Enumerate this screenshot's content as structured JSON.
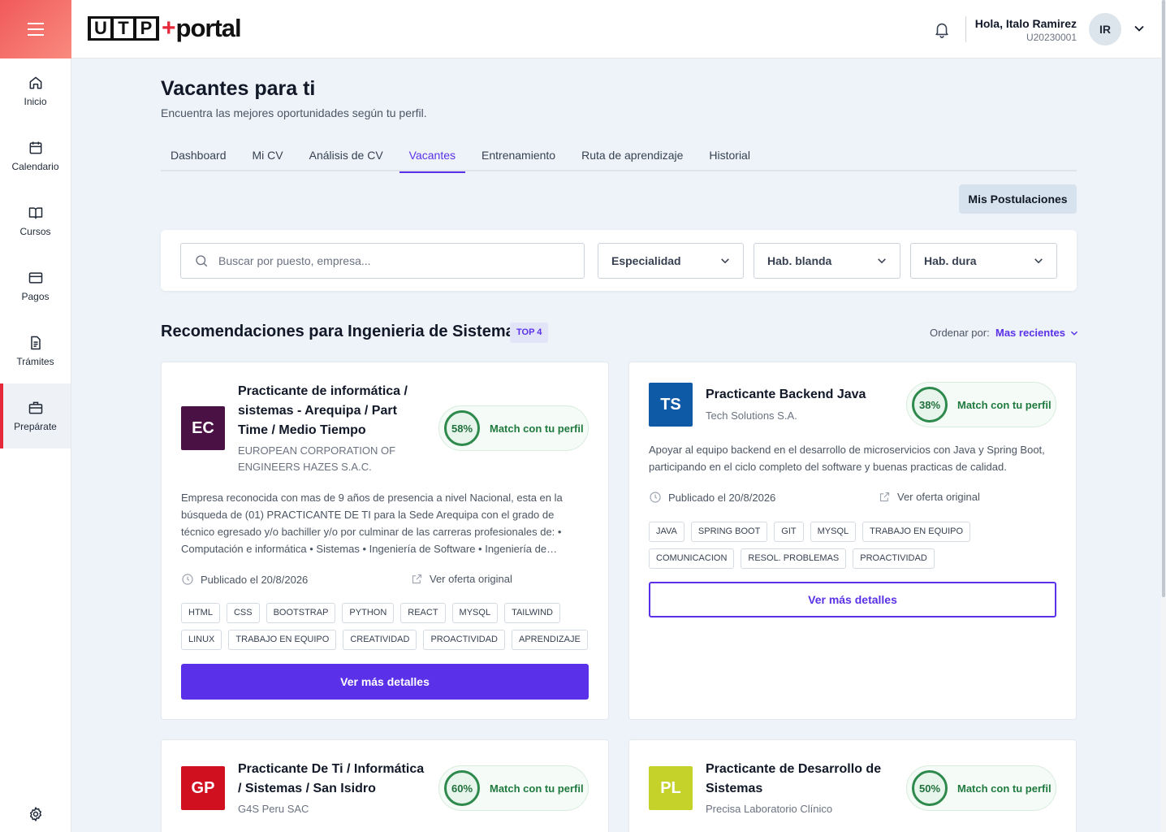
{
  "sidebar": {
    "items": [
      {
        "label": "Inicio",
        "icon": "home-icon"
      },
      {
        "label": "Calendario",
        "icon": "calendar-icon"
      },
      {
        "label": "Cursos",
        "icon": "book-icon"
      },
      {
        "label": "Pagos",
        "icon": "credit-card-icon"
      },
      {
        "label": "Trámites",
        "icon": "document-icon"
      },
      {
        "label": "Prepárate",
        "icon": "briefcase-icon"
      }
    ],
    "active": "Prepárate"
  },
  "header": {
    "logo_letters": [
      "U",
      "T",
      "P"
    ],
    "logo_plus": "+",
    "logo_word": "portal",
    "user_greeting": "Hola, Italo Ramirez",
    "user_code": "U20230001",
    "avatar_initials": "IR"
  },
  "page": {
    "title": "Vacantes para ti",
    "subtitle": "Encuentra las mejores oportunidades según tu perfil."
  },
  "tabs": [
    {
      "label": "Dashboard"
    },
    {
      "label": "Mi CV"
    },
    {
      "label": "Análisis de CV"
    },
    {
      "label": "Vacantes"
    },
    {
      "label": "Entrenamiento"
    },
    {
      "label": "Ruta de aprendizaje"
    },
    {
      "label": "Historial"
    }
  ],
  "active_tab": "Vacantes",
  "postulaciones_label": "Mis Postulaciones",
  "filters": {
    "search_placeholder": "Buscar por puesto, empresa...",
    "especialidad": "Especialidad",
    "hab_blanda": "Hab. blanda",
    "hab_dura": "Hab. dura"
  },
  "section": {
    "title": "Recomendaciones para Ingenieria de Sistemas",
    "badge": "TOP 4",
    "sort_label": "Ordenar por:",
    "sort_value": "Mas recientes"
  },
  "jobs": [
    {
      "initials": "EC",
      "logo_color": "#4a1244",
      "title": "Practicante de informática / sistemas - Arequipa / Part Time / Medio Tiempo",
      "company": "EUROPEAN CORPORATION OF ENGINEERS HAZES S.A.C.",
      "match": "58%",
      "match_label": "Match con tu perfil",
      "description": "Empresa reconocida con mas de 9 años de presencia a nivel Nacional, esta en la búsqueda de (01) PRACTICANTE DE TI para la Sede Arequipa con el grado de técnico egresado y/o bachiller y/o por culminar de las carreras profesionales de: • Computación e informática • Sistemas • Ingeniería de Software • Ingeniería de…",
      "published": "Publicado el 20/8/2026",
      "original_link": "Ver oferta original",
      "tags": [
        "HTML",
        "CSS",
        "BOOTSTRAP",
        "PYTHON",
        "REACT",
        "MYSQL",
        "TAILWIND",
        "LINUX",
        "TRABAJO EN EQUIPO",
        "CREATIVIDAD",
        "PROACTIVIDAD",
        "APRENDIZAJE"
      ],
      "button": "Ver más detalles"
    },
    {
      "initials": "TS",
      "logo_color": "#0f5aa6",
      "title": "Practicante Backend Java",
      "company": "Tech Solutions S.A.",
      "match": "38%",
      "match_label": "Match con tu perfil",
      "description": "Apoyar al equipo backend en el desarrollo de microservicios con Java y Spring Boot, participando en el ciclo completo del software y buenas practicas de calidad.",
      "published": "Publicado el 20/8/2026",
      "original_link": "Ver oferta original",
      "tags": [
        "JAVA",
        "SPRING BOOT",
        "GIT",
        "MYSQL",
        "TRABAJO EN EQUIPO",
        "COMUNICACION",
        "RESOL. PROBLEMAS",
        "PROACTIVIDAD"
      ],
      "button": "Ver más detalles"
    },
    {
      "initials": "GP",
      "logo_color": "#d0101f",
      "title": "Practicante De Ti / Informática / Sistemas / San Isidro",
      "company": "G4S Peru SAC",
      "match": "60%",
      "match_label": "Match con tu perfil"
    },
    {
      "initials": "PL",
      "logo_color": "#c4d22a",
      "title": "Practicante de Desarrollo de Sistemas",
      "company": "Precisa Laboratorio Clínico",
      "match": "50%",
      "match_label": "Match con tu perfil"
    }
  ],
  "colors": {
    "accent": "#5a31e8",
    "brand_red": "#e5293a",
    "match_green": "#2e8a4c",
    "background": "#edf3f9"
  }
}
